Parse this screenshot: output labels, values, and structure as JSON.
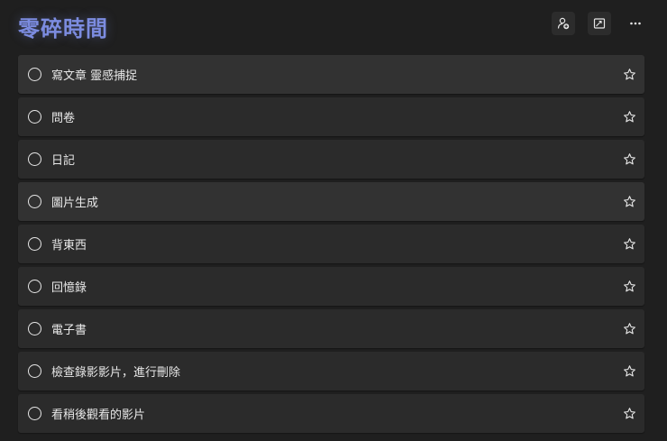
{
  "list": {
    "title": "零碎時間"
  },
  "toolbar": {
    "share_icon": "share-person-icon",
    "view_icon": "image-view-icon",
    "more_icon": "more-options-icon"
  },
  "tasks": [
    {
      "label": "寫文章 靈感捕捉",
      "completed": false,
      "important": false
    },
    {
      "label": "問卷",
      "completed": false,
      "important": false
    },
    {
      "label": "日記",
      "completed": false,
      "important": false
    },
    {
      "label": "圖片生成",
      "completed": false,
      "important": false
    },
    {
      "label": "背東西",
      "completed": false,
      "important": false
    },
    {
      "label": "回憶錄",
      "completed": false,
      "important": false
    },
    {
      "label": "電子書",
      "completed": false,
      "important": false
    },
    {
      "label": "檢查錄影影片，進行刪除",
      "completed": false,
      "important": false
    },
    {
      "label": "看稍後觀看的影片",
      "completed": false,
      "important": false
    }
  ],
  "colors": {
    "title": "#7c8ce0",
    "background": "#1f1f1f",
    "card": "#2b2b2b"
  }
}
